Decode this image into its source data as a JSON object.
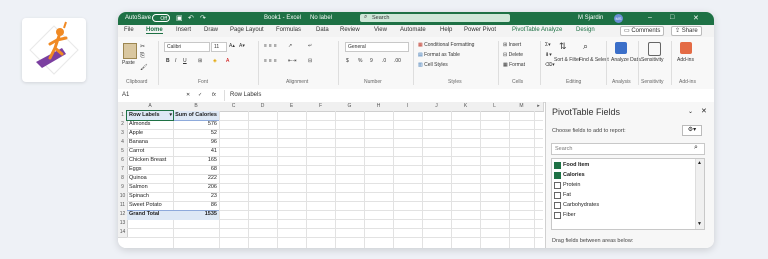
{
  "titlebar": {
    "autosave_label": "AutoSave",
    "autosave_toggle": "Off",
    "file_name": "Book1 - Excel",
    "sensitivity": "No label",
    "search_placeholder": "Search",
    "user_name": "M Sjardin",
    "user_initials": "MS"
  },
  "tabs": [
    "File",
    "Home",
    "Insert",
    "Draw",
    "Page Layout",
    "Formulas",
    "Data",
    "Review",
    "View",
    "Automate",
    "Help",
    "Power Pivot",
    "PivotTable Analyze",
    "Design"
  ],
  "tab_actions": {
    "comments": "Comments",
    "share": "Share"
  },
  "ribbon": {
    "paste": "Paste",
    "font_name": "Calibri",
    "font_size": "11",
    "number_format": "General",
    "cond_format": "Conditional Formatting",
    "format_table": "Format as Table",
    "cell_styles": "Cell Styles",
    "insert": "Insert",
    "delete": "Delete",
    "format": "Format",
    "sort_filter": "Sort & Filter",
    "find_select": "Find & Select",
    "analyze_data": "Analyze Data",
    "sensitivity": "Sensitivity",
    "addins": "Add-ins",
    "groups": {
      "clipboard": "Clipboard",
      "font": "Font",
      "alignment": "Alignment",
      "number": "Number",
      "styles": "Styles",
      "cells": "Cells",
      "editing": "Editing",
      "analysis": "Analysis",
      "sensitivity": "Sensitivity",
      "addins": "Add-ins"
    }
  },
  "formula_bar": {
    "name_box": "A1",
    "fx": "fx",
    "content": "Row Labels"
  },
  "columns": [
    "A",
    "B",
    "C",
    "D",
    "E",
    "F",
    "G",
    "H",
    "I",
    "J",
    "K",
    "L",
    "M"
  ],
  "pivot": {
    "header": [
      "Row Labels",
      "Sum of Calories"
    ],
    "rows": [
      [
        "Almonds",
        "576"
      ],
      [
        "Apple",
        "52"
      ],
      [
        "Banana",
        "96"
      ],
      [
        "Carrot",
        "41"
      ],
      [
        "Chicken Breast",
        "165"
      ],
      [
        "Eggs",
        "68"
      ],
      [
        "Quinoa",
        "222"
      ],
      [
        "Salmon",
        "206"
      ],
      [
        "Spinach",
        "23"
      ],
      [
        "Sweet Potato",
        "86"
      ]
    ],
    "total": [
      "Grand Total",
      "1535"
    ]
  },
  "row_numbers": [
    "1",
    "2",
    "3",
    "4",
    "5",
    "6",
    "7",
    "8",
    "9",
    "10",
    "11",
    "12",
    "13",
    "14"
  ],
  "pane": {
    "title": "PivotTable Fields",
    "subtitle": "Choose fields to add to report:",
    "search_placeholder": "Search",
    "fields": [
      {
        "label": "Food Item",
        "checked": true
      },
      {
        "label": "Calories",
        "checked": true
      },
      {
        "label": "Protein",
        "checked": false
      },
      {
        "label": "Fat",
        "checked": false
      },
      {
        "label": "Carbohydrates",
        "checked": false
      },
      {
        "label": "Fiber",
        "checked": false
      }
    ],
    "drag_hint": "Drag fields between areas below:"
  }
}
